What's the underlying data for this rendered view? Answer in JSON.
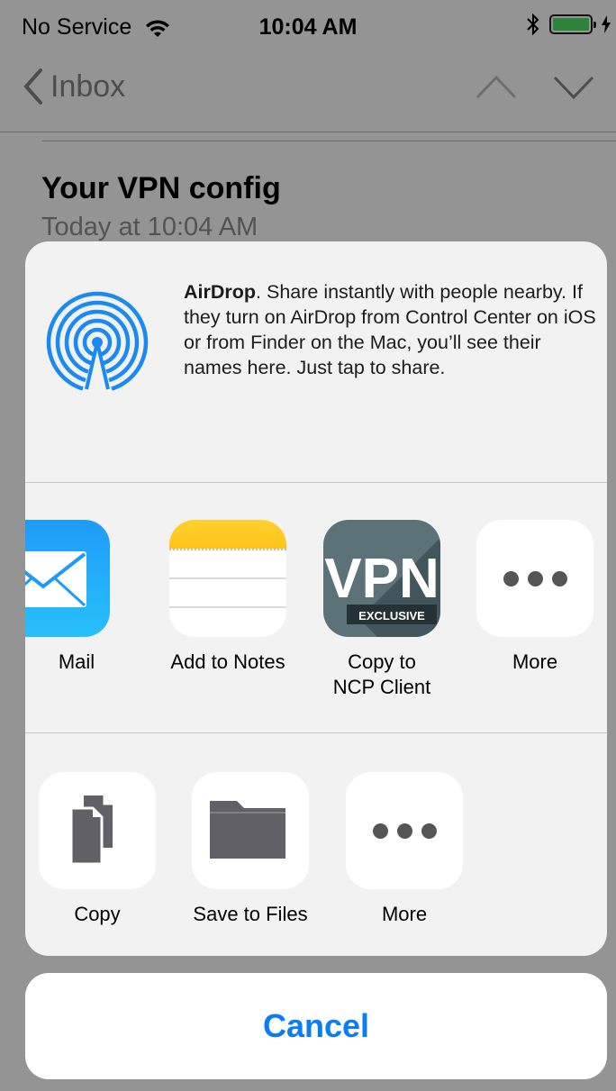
{
  "status": {
    "carrier": "No Service",
    "time": "10:04 AM"
  },
  "nav": {
    "back_label": "Inbox"
  },
  "mail": {
    "subject": "Your VPN config",
    "date": "Today at 10:04 AM"
  },
  "airdrop": {
    "title": "AirDrop",
    "description": ". Share instantly with people nearby. If they turn on AirDrop from Control Center on iOS or from Finder on the Mac, you’ll see their names here. Just tap to share."
  },
  "apps": [
    {
      "label": "Mail",
      "icon": "mail-icon"
    },
    {
      "label": "Add to Notes",
      "icon": "notes-icon"
    },
    {
      "label": "Copy to\nNCP Client",
      "icon": "vpn-icon"
    },
    {
      "label": "More",
      "icon": "more-icon"
    }
  ],
  "vpn_icon": {
    "big": "VPN",
    "small": "EXCLUSIVE"
  },
  "actions": [
    {
      "label": "Copy",
      "icon": "copy-icon"
    },
    {
      "label": "Save to Files",
      "icon": "folder-icon"
    },
    {
      "label": "More",
      "icon": "more-icon"
    }
  ],
  "cancel_label": "Cancel",
  "colors": {
    "accent": "#0a7cf5",
    "mail_blue": "#1e9bf8",
    "notes_yellow": "#ffd12e",
    "battery_green": "#4cd964",
    "vpn_bg": "#5c7279"
  }
}
